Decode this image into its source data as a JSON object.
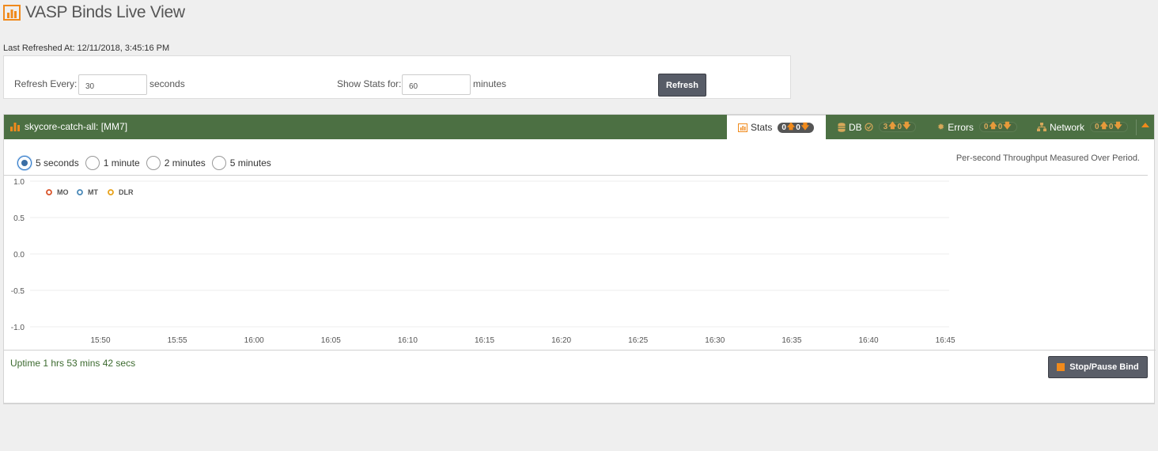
{
  "header": {
    "title": "VASP Binds Live View",
    "last_refreshed": "Last Refreshed At: 12/11/2018, 3:45:16 PM"
  },
  "controls": {
    "refresh_every_label": "Refresh Every:",
    "refresh_every_value": "30",
    "refresh_every_unit": "seconds",
    "show_stats_label": "Show Stats for:",
    "show_stats_value": "60",
    "show_stats_unit": "minutes",
    "refresh_button": "Refresh"
  },
  "bind": {
    "title": "skycore-catch-all: [MM7]",
    "tabs": [
      {
        "label": "Stats",
        "up": "0",
        "down": "0",
        "active": true,
        "icon": "bar-chart-icon"
      },
      {
        "label": "DB",
        "count": "3",
        "up": "0",
        "active": false,
        "icon": "database-icon"
      },
      {
        "label": "Errors",
        "up": "0",
        "down": "0",
        "active": false,
        "icon": "bug-icon"
      },
      {
        "label": "Network",
        "up": "0",
        "down": "0",
        "active": false,
        "icon": "network-icon"
      }
    ],
    "periods": [
      {
        "label": "5 seconds",
        "selected": true
      },
      {
        "label": "1 minute",
        "selected": false
      },
      {
        "label": "2 minutes",
        "selected": false
      },
      {
        "label": "5 minutes",
        "selected": false
      }
    ],
    "throughput_note": "Per-second Throughput Measured Over Period.",
    "uptime": "Uptime 1 hrs 53 mins 42 secs",
    "stop_button": "Stop/Pause Bind"
  },
  "chart_data": {
    "type": "line",
    "x_ticks": [
      "15:50",
      "15:55",
      "16:00",
      "16:05",
      "16:10",
      "16:15",
      "16:20",
      "16:25",
      "16:30",
      "16:35",
      "16:40",
      "16:45"
    ],
    "y_ticks": [
      "1.0",
      "0.5",
      "0.0",
      "-0.5",
      "-1.0"
    ],
    "ylim": [
      -1.0,
      1.0
    ],
    "grid": true,
    "legend_position": "top-left",
    "series": [
      {
        "name": "MO",
        "color": "#d9542a",
        "values": []
      },
      {
        "name": "MT",
        "color": "#4a89b8",
        "values": []
      },
      {
        "name": "DLR",
        "color": "#e8a21a",
        "values": []
      }
    ]
  },
  "colors": {
    "header_green": "#4c7043",
    "accent_orange": "#f08a1c",
    "button_gray": "#575c67"
  }
}
